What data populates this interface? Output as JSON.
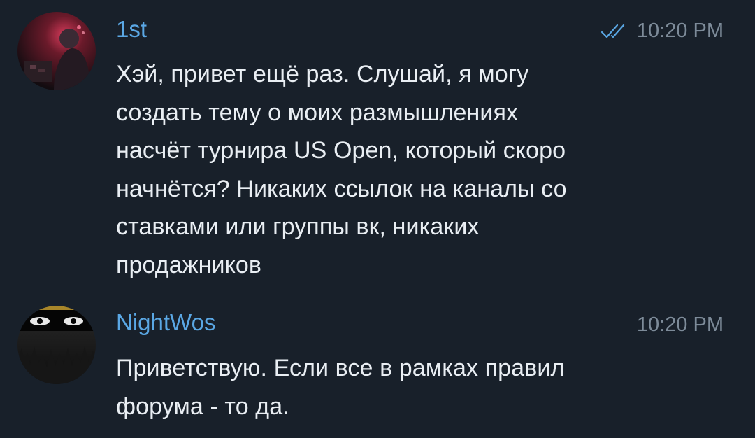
{
  "messages": [
    {
      "sender": "1st",
      "time": "10:20 PM",
      "read_icon": "double-check-icon",
      "text": "Хэй, привет ещё раз. Слушай, я могу\nсоздать тему о моих размышлениях\nнасчёт турнира US Open, который скоро\nначнётся? Никаких ссылок на каналы со\nставками или группы вк, никаких\nпродажников"
    },
    {
      "sender": "NightWos",
      "time": "10:20 PM",
      "text": "Приветствую. Если все в рамках правил\nфорума - то да."
    }
  ],
  "colors": {
    "background": "#18202a",
    "sender_name": "#5aa7e4",
    "message_text": "#e9eef3",
    "meta": "#7d8b99"
  }
}
